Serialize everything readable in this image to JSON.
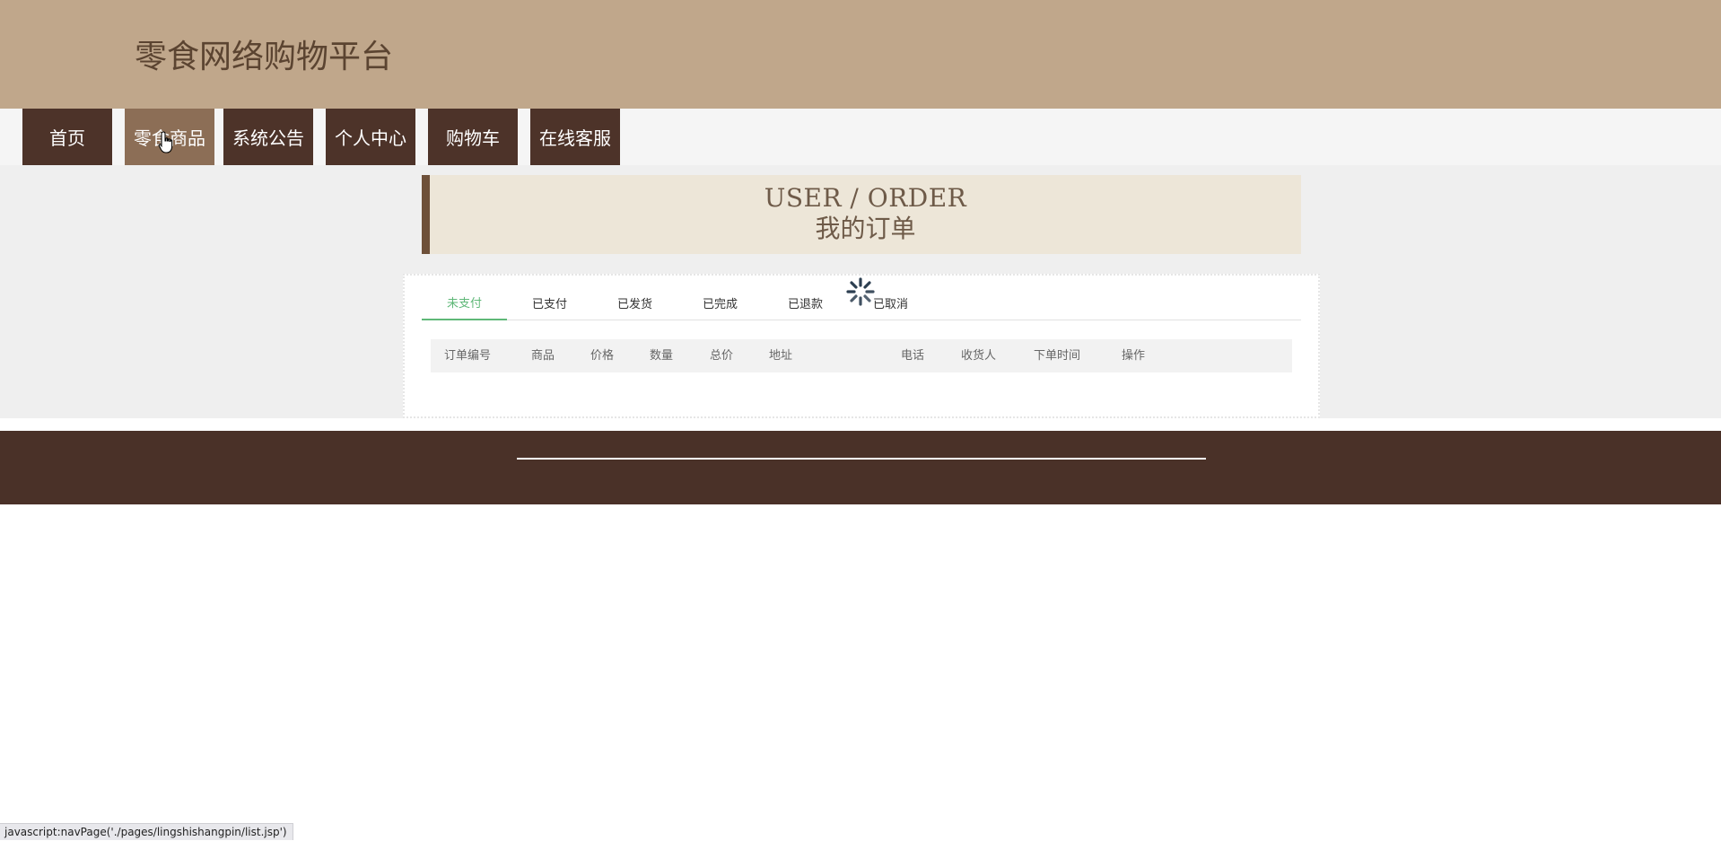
{
  "header": {
    "title": "零食网络购物平台"
  },
  "nav": {
    "items": [
      {
        "label": "首页"
      },
      {
        "label": "零食商品"
      },
      {
        "label": "系统公告"
      },
      {
        "label": "个人中心"
      },
      {
        "label": "购物车"
      },
      {
        "label": "在线客服"
      }
    ],
    "hovered": "零食商品"
  },
  "banner": {
    "title_en": "USER / ORDER",
    "title_cn": "我的订单"
  },
  "order_tabs": {
    "items": [
      {
        "label": "未支付"
      },
      {
        "label": "已支付"
      },
      {
        "label": "已发货"
      },
      {
        "label": "已完成"
      },
      {
        "label": "已退款"
      },
      {
        "label": "已取消"
      }
    ],
    "active": "未支付"
  },
  "table": {
    "headers": [
      "订单编号",
      "商品",
      "价格",
      "数量",
      "总价",
      "地址",
      "电话",
      "收货人",
      "下单时间",
      "操作"
    ],
    "rows": []
  },
  "status_bar": {
    "text": "javascript:navPage('./pages/lingshishangpin/list.jsp')"
  },
  "colors": {
    "header_bg": "#c0a78b",
    "nav_bg": "#4d3329",
    "nav_hover_bg": "#8c6e56",
    "tab_active": "#5fb878",
    "footer_bg": "#4a3128"
  },
  "icons": {
    "loading": "loading-spinner-icon",
    "cursor": "hand-pointer-cursor-icon"
  }
}
